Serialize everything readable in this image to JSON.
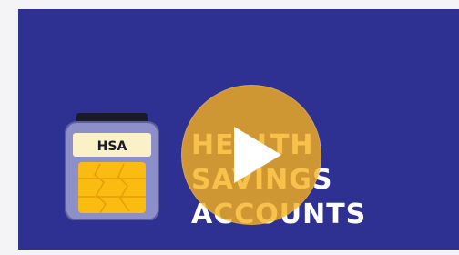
{
  "video": {
    "title": "HEALTH SAVINGS\nACCOUNTS",
    "jar_label": "HSA"
  },
  "colors": {
    "background": "#2e3192",
    "play_button": "#f6b11b",
    "jar_glass": "#8d8fc9",
    "jar_label": "#fbf1c9",
    "coins": "#fbbc12"
  },
  "icons": {
    "play": "play-icon",
    "jar": "hsa-jar-icon"
  }
}
